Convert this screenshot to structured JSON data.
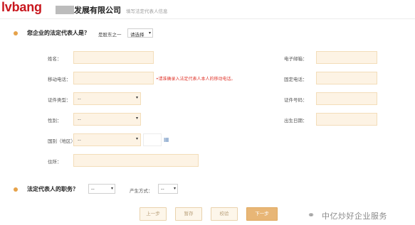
{
  "header": {
    "logo_text": "lvbang",
    "company_name": "发展有限公司",
    "subtitle": "填写法定代表人信息"
  },
  "section1": {
    "question": "您企业的法定代表人是？",
    "note": "是股东之一",
    "select_value": "请选择"
  },
  "fields": {
    "name_label": "姓名：",
    "mobile_label": "移动电话：",
    "mobile_error": "•请准确录入法定代表人本人的移动电话。",
    "id_type_label": "证件类型：",
    "id_type_value": "--",
    "gender_label": "性别：",
    "gender_value": "--",
    "country_label": "国别（地区）：",
    "country_value": "--",
    "address_label": "住所：",
    "email_label": "电子邮箱：",
    "landline_label": "固定电话：",
    "id_number_label": "证件号码：",
    "birthdate_label": "出生日期："
  },
  "section2": {
    "question": "法定代表人的职务？",
    "position_value": "--",
    "method_label": "产生方式：",
    "method_value": "--"
  },
  "buttons": {
    "prev": "上一步",
    "save": "暂存",
    "check": "校验",
    "next": "下一步"
  },
  "watermark": {
    "text": "中亿炒好企业服务"
  },
  "colors": {
    "field_bg": "#fdf3e4",
    "accent": "#e8b676",
    "error": "#e0352b",
    "logo": "#c8171e"
  }
}
